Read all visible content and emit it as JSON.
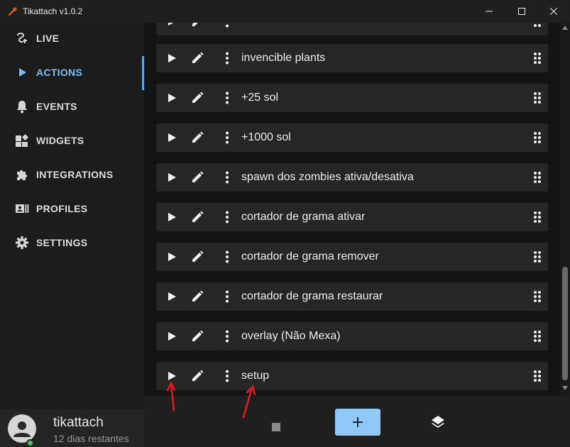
{
  "window": {
    "title": "Tikattach v1.0.2"
  },
  "sidebar": {
    "items": [
      {
        "label": "LIVE",
        "icon": "live-icon"
      },
      {
        "label": "ACTIONS",
        "icon": "play-arrow-icon",
        "active": true
      },
      {
        "label": "EVENTS",
        "icon": "bell-icon"
      },
      {
        "label": "WIDGETS",
        "icon": "widgets-icon"
      },
      {
        "label": "INTEGRATIONS",
        "icon": "puzzle-icon"
      },
      {
        "label": "PROFILES",
        "icon": "id-card-icon"
      },
      {
        "label": "SETTINGS",
        "icon": "gear-icon"
      }
    ],
    "user": {
      "name": "tikattach",
      "subtitle": "12 dias restantes",
      "status_color": "#4fc24f"
    }
  },
  "actions": {
    "rows": [
      {
        "label": ""
      },
      {
        "label": "invencible plants"
      },
      {
        "label": "+25 sol"
      },
      {
        "label": "+1000 sol"
      },
      {
        "label": "spawn dos zombies ativa/desativa"
      },
      {
        "label": "cortador de grama ativar"
      },
      {
        "label": "cortador de grama remover"
      },
      {
        "label": "cortador de grama restaurar"
      },
      {
        "label": "overlay (Não Mexa)"
      },
      {
        "label": "setup"
      }
    ]
  },
  "colors": {
    "accent": "#5aa6e8",
    "active_label": "#7fbdf0",
    "add_button": "#90c8f8",
    "annotation_arrow": "#e01c1c"
  }
}
